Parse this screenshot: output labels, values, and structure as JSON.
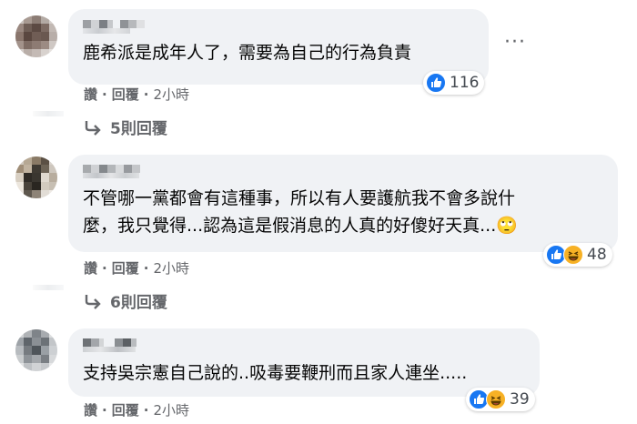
{
  "comments": [
    {
      "text_lines": [
        "鹿希派是成年人了，需要為自己的行為負責"
      ],
      "reaction_count": "116",
      "reactions": [
        "like-icon"
      ],
      "actions": {
        "like": "讚",
        "reply": "回覆",
        "sep": "·",
        "time": "2小時"
      },
      "replies_label": "5則回覆",
      "more": "···"
    },
    {
      "text_lines": [
        "不管哪一黨都會有這種事，所以有人要護航我不會多說什",
        "麼，我只覺得...認為這是假消息的人真的好傻好天真...🙄"
      ],
      "reaction_count": "48",
      "reactions": [
        "like-icon",
        "haha-icon"
      ],
      "actions": {
        "like": "讚",
        "reply": "回覆",
        "sep": "·",
        "time": "2小時"
      },
      "replies_label": "6則回覆"
    },
    {
      "text_lines": [
        "支持吳宗憲自己說的..吸毒要鞭刑而且家人連坐....."
      ],
      "reaction_count": "39",
      "reactions": [
        "like-icon",
        "haha-icon"
      ],
      "actions": {
        "like": "讚",
        "reply": "回覆",
        "sep": "·",
        "time": "2小時"
      }
    }
  ],
  "colors": {
    "bubble": "#f0f2f5",
    "like": "#1877f2",
    "haha": "#f7b125",
    "meta_text": "#65676b"
  }
}
